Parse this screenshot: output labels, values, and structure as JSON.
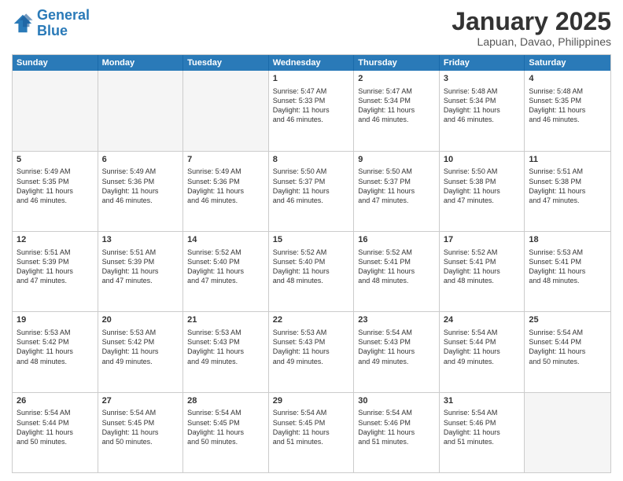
{
  "header": {
    "logo_line1": "General",
    "logo_line2": "Blue",
    "month_title": "January 2025",
    "location": "Lapuan, Davao, Philippines"
  },
  "days_of_week": [
    "Sunday",
    "Monday",
    "Tuesday",
    "Wednesday",
    "Thursday",
    "Friday",
    "Saturday"
  ],
  "weeks": [
    [
      {
        "day": "",
        "info": ""
      },
      {
        "day": "",
        "info": ""
      },
      {
        "day": "",
        "info": ""
      },
      {
        "day": "1",
        "info": "Sunrise: 5:47 AM\nSunset: 5:33 PM\nDaylight: 11 hours\nand 46 minutes."
      },
      {
        "day": "2",
        "info": "Sunrise: 5:47 AM\nSunset: 5:34 PM\nDaylight: 11 hours\nand 46 minutes."
      },
      {
        "day": "3",
        "info": "Sunrise: 5:48 AM\nSunset: 5:34 PM\nDaylight: 11 hours\nand 46 minutes."
      },
      {
        "day": "4",
        "info": "Sunrise: 5:48 AM\nSunset: 5:35 PM\nDaylight: 11 hours\nand 46 minutes."
      }
    ],
    [
      {
        "day": "5",
        "info": "Sunrise: 5:49 AM\nSunset: 5:35 PM\nDaylight: 11 hours\nand 46 minutes."
      },
      {
        "day": "6",
        "info": "Sunrise: 5:49 AM\nSunset: 5:36 PM\nDaylight: 11 hours\nand 46 minutes."
      },
      {
        "day": "7",
        "info": "Sunrise: 5:49 AM\nSunset: 5:36 PM\nDaylight: 11 hours\nand 46 minutes."
      },
      {
        "day": "8",
        "info": "Sunrise: 5:50 AM\nSunset: 5:37 PM\nDaylight: 11 hours\nand 46 minutes."
      },
      {
        "day": "9",
        "info": "Sunrise: 5:50 AM\nSunset: 5:37 PM\nDaylight: 11 hours\nand 47 minutes."
      },
      {
        "day": "10",
        "info": "Sunrise: 5:50 AM\nSunset: 5:38 PM\nDaylight: 11 hours\nand 47 minutes."
      },
      {
        "day": "11",
        "info": "Sunrise: 5:51 AM\nSunset: 5:38 PM\nDaylight: 11 hours\nand 47 minutes."
      }
    ],
    [
      {
        "day": "12",
        "info": "Sunrise: 5:51 AM\nSunset: 5:39 PM\nDaylight: 11 hours\nand 47 minutes."
      },
      {
        "day": "13",
        "info": "Sunrise: 5:51 AM\nSunset: 5:39 PM\nDaylight: 11 hours\nand 47 minutes."
      },
      {
        "day": "14",
        "info": "Sunrise: 5:52 AM\nSunset: 5:40 PM\nDaylight: 11 hours\nand 47 minutes."
      },
      {
        "day": "15",
        "info": "Sunrise: 5:52 AM\nSunset: 5:40 PM\nDaylight: 11 hours\nand 48 minutes."
      },
      {
        "day": "16",
        "info": "Sunrise: 5:52 AM\nSunset: 5:41 PM\nDaylight: 11 hours\nand 48 minutes."
      },
      {
        "day": "17",
        "info": "Sunrise: 5:52 AM\nSunset: 5:41 PM\nDaylight: 11 hours\nand 48 minutes."
      },
      {
        "day": "18",
        "info": "Sunrise: 5:53 AM\nSunset: 5:41 PM\nDaylight: 11 hours\nand 48 minutes."
      }
    ],
    [
      {
        "day": "19",
        "info": "Sunrise: 5:53 AM\nSunset: 5:42 PM\nDaylight: 11 hours\nand 48 minutes."
      },
      {
        "day": "20",
        "info": "Sunrise: 5:53 AM\nSunset: 5:42 PM\nDaylight: 11 hours\nand 49 minutes."
      },
      {
        "day": "21",
        "info": "Sunrise: 5:53 AM\nSunset: 5:43 PM\nDaylight: 11 hours\nand 49 minutes."
      },
      {
        "day": "22",
        "info": "Sunrise: 5:53 AM\nSunset: 5:43 PM\nDaylight: 11 hours\nand 49 minutes."
      },
      {
        "day": "23",
        "info": "Sunrise: 5:54 AM\nSunset: 5:43 PM\nDaylight: 11 hours\nand 49 minutes."
      },
      {
        "day": "24",
        "info": "Sunrise: 5:54 AM\nSunset: 5:44 PM\nDaylight: 11 hours\nand 49 minutes."
      },
      {
        "day": "25",
        "info": "Sunrise: 5:54 AM\nSunset: 5:44 PM\nDaylight: 11 hours\nand 50 minutes."
      }
    ],
    [
      {
        "day": "26",
        "info": "Sunrise: 5:54 AM\nSunset: 5:44 PM\nDaylight: 11 hours\nand 50 minutes."
      },
      {
        "day": "27",
        "info": "Sunrise: 5:54 AM\nSunset: 5:45 PM\nDaylight: 11 hours\nand 50 minutes."
      },
      {
        "day": "28",
        "info": "Sunrise: 5:54 AM\nSunset: 5:45 PM\nDaylight: 11 hours\nand 50 minutes."
      },
      {
        "day": "29",
        "info": "Sunrise: 5:54 AM\nSunset: 5:45 PM\nDaylight: 11 hours\nand 51 minutes."
      },
      {
        "day": "30",
        "info": "Sunrise: 5:54 AM\nSunset: 5:46 PM\nDaylight: 11 hours\nand 51 minutes."
      },
      {
        "day": "31",
        "info": "Sunrise: 5:54 AM\nSunset: 5:46 PM\nDaylight: 11 hours\nand 51 minutes."
      },
      {
        "day": "",
        "info": ""
      }
    ]
  ]
}
